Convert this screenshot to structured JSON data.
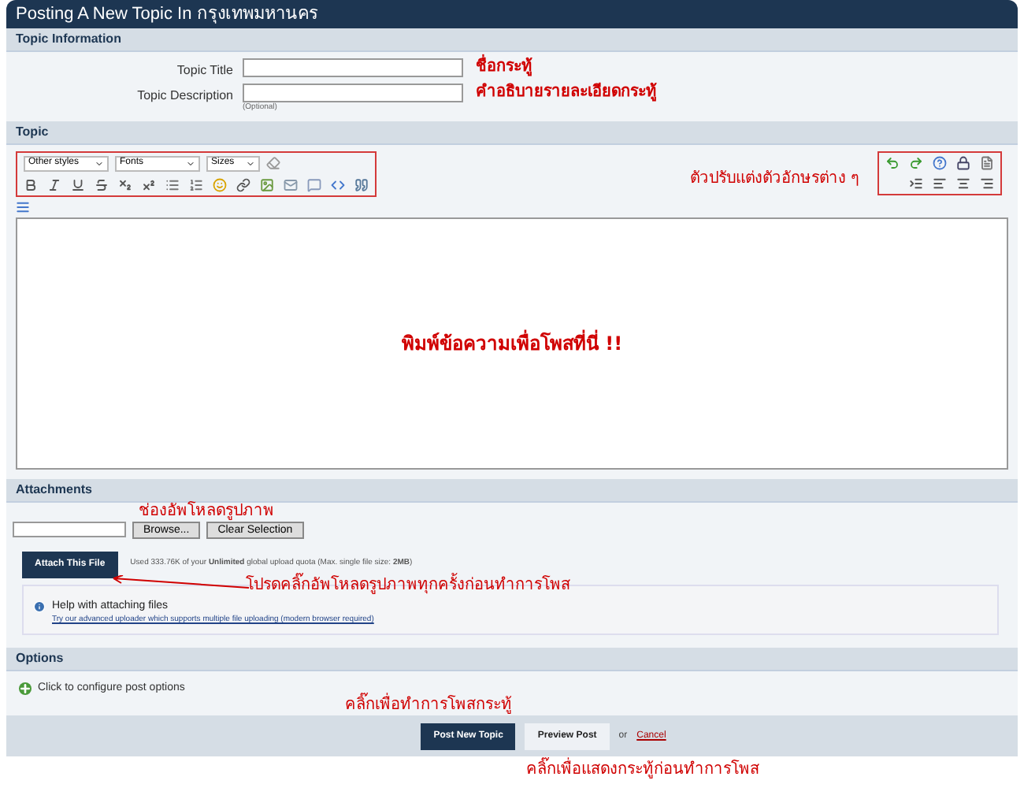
{
  "window": {
    "title": "Posting A New Topic In กรุงเทพมหานคร"
  },
  "topic_information": {
    "header": "Topic Information",
    "fields": [
      {
        "label": "Topic Title",
        "note": "ชื่อกระทู้"
      },
      {
        "label": "Topic Description",
        "hint": "(Optional)",
        "note": "คำอธิบายรายละเอียดกระทู้"
      }
    ]
  },
  "topic": {
    "header": "Topic",
    "style_selects": [
      "Other styles",
      "Fonts",
      "Sizes"
    ],
    "toolbar_note": "ตัวปรับแต่งตัวอักษรต่าง ๆ",
    "editor_note": "พิมพ์ข้อความเพื่อโพสที่นี่ !!"
  },
  "attachments": {
    "header": "Attachments",
    "upload_note": "ช่องอัพโหลดรูปภาพ",
    "browse": "Browse...",
    "clear": "Clear Selection",
    "attach": "Attach This File",
    "quota": "Used 333.76K of your **Unlimited** global upload quota (Max. single file size: **2MB**)",
    "attach_note": "โปรดคลิ๊กอัพโหลดรูปภาพทุกครั้งก่อนทำการโพส",
    "help_title": "Help with attaching files",
    "help_link": "Try our advanced uploader which supports multiple file uploading (modern browser required)"
  },
  "options": {
    "header": "Options",
    "configure": "Click to configure post options"
  },
  "footer": {
    "post_note": "คลิ๊กเพื่อทำการโพสกระทู้",
    "post": "Post New Topic",
    "preview": "Preview Post",
    "or": "or",
    "cancel": "Cancel",
    "preview_note": "คลิ๊กเพื่อแสดงกระทู้ก่อนทำการโพส"
  }
}
